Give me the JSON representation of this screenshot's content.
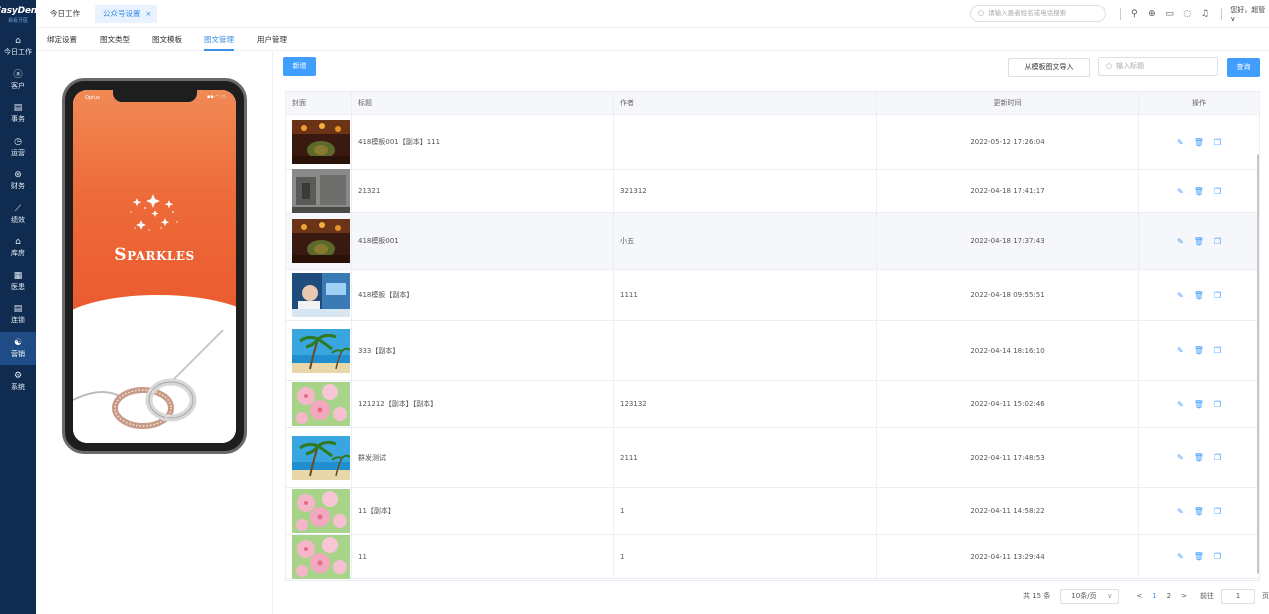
{
  "logo": {
    "title": "EasyDent",
    "subtitle": "易看牙医"
  },
  "sidebar": {
    "items": [
      {
        "icon": "⌂",
        "label": "今日工作",
        "active": false
      },
      {
        "icon": "ⓐ",
        "label": "客户",
        "active": false
      },
      {
        "icon": "▤",
        "label": "事务",
        "active": false
      },
      {
        "icon": "◷",
        "label": "运营",
        "active": false
      },
      {
        "icon": "⊛",
        "label": "财务",
        "active": false
      },
      {
        "icon": "⟋",
        "label": "绩效",
        "active": false
      },
      {
        "icon": "⌂",
        "label": "库房",
        "active": false
      },
      {
        "icon": "▦",
        "label": "医患",
        "active": false
      },
      {
        "icon": "▤",
        "label": "连锁",
        "active": false
      },
      {
        "icon": "☯",
        "label": "营销",
        "active": true
      },
      {
        "icon": "⚙",
        "label": "系统",
        "active": false
      }
    ]
  },
  "topbar": {
    "tabs": [
      {
        "label": "今日工作"
      },
      {
        "label": "公众号设置",
        "close": "×"
      }
    ],
    "search_placeholder": "请输入患者姓名或电话搜索",
    "user_greeting": "您好，超管 ∨"
  },
  "subtabs": [
    "绑定设置",
    "图文类型",
    "图文模板",
    "图文管理",
    "用户管理"
  ],
  "active_subtab": "图文管理",
  "preview": {
    "status_left": "Optus",
    "status_right": "▪▪ ◠ ▭",
    "headline": "Sparkles"
  },
  "toolbar": {
    "add_label": "新增",
    "import_label": "从模板图文导入",
    "title_search_placeholder": "输入标题",
    "query_label": "查询"
  },
  "table": {
    "headers": {
      "cover": "封面",
      "title": "标题",
      "author": "作者",
      "updated": "更新时间",
      "ops": "操作"
    },
    "rows": [
      {
        "cover": "dark-dinner",
        "title": "418模板001【副本】111",
        "author": "",
        "updated": "2022-05-12 17:26:04"
      },
      {
        "cover": "stone-wall",
        "title": "21321",
        "author": "321312",
        "updated": "2022-04-18 17:41:17"
      },
      {
        "cover": "dark-dinner",
        "title": "418模板001",
        "author": "小五",
        "updated": "2022-04-18 17:37:43"
      },
      {
        "cover": "blue-office",
        "title": "418模板【副本】",
        "author": "1111",
        "updated": "2022-04-18 09:55:51"
      },
      {
        "cover": "palm-beach",
        "title": "333【副本】",
        "author": "",
        "updated": "2022-04-14 18:16:10"
      },
      {
        "cover": "pink-blossom",
        "title": "121212【副本】【副本】",
        "author": "123132",
        "updated": "2022-04-11 15:02:46"
      },
      {
        "cover": "palm-beach",
        "title": "群发测试",
        "author": "2111",
        "updated": "2022-04-11 17:48:53"
      },
      {
        "cover": "pink-blossom",
        "title": "11【副本】",
        "author": "1",
        "updated": "2022-04-11 14:58:22"
      },
      {
        "cover": "pink-blossom",
        "title": "11",
        "author": "1",
        "updated": "2022-04-11 13:29:44"
      }
    ]
  },
  "pagination": {
    "total": "共 15 条",
    "page_size": "10条/页",
    "prev": "<",
    "pages": [
      "1",
      "2"
    ],
    "current_page": "1",
    "next": ">",
    "goto_label": "前往",
    "goto_value": "1",
    "goto_suffix": "页"
  },
  "colors": {
    "primary": "#409eff",
    "sidebar_bg": "#0f2b4f",
    "sidebar_active": "#1f4c85",
    "preview_gradient": "#ee6b3a"
  }
}
